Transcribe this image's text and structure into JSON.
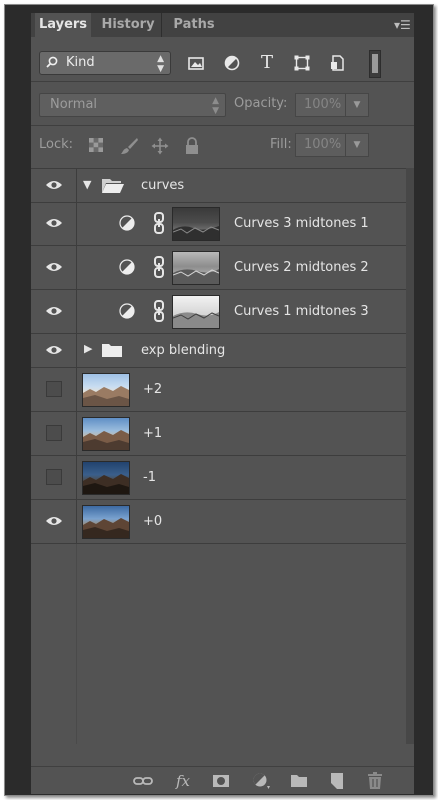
{
  "tabs": [
    {
      "label": "Layers",
      "active": true
    },
    {
      "label": "History",
      "active": false
    },
    {
      "label": "Paths",
      "active": false
    }
  ],
  "panel_menu_icon": "panel-menu-icon",
  "filter": {
    "kind_label": "Kind",
    "icons": [
      "image-filter-icon",
      "adjustment-filter-icon",
      "type-filter-icon",
      "shape-filter-icon",
      "smart-object-filter-icon"
    ],
    "type_glyph": "T"
  },
  "blend": {
    "mode": "Normal",
    "opacity_label": "Opacity:",
    "opacity_value": "100%"
  },
  "lock": {
    "label": "Lock:",
    "fill_label": "Fill:",
    "fill_value": "100%",
    "icons": [
      "lock-transparent-icon",
      "lock-image-icon",
      "lock-position-icon",
      "lock-all-icon"
    ]
  },
  "layers": [
    {
      "name": "curves",
      "kind": "group",
      "expanded": true,
      "visible": true,
      "indent": 0
    },
    {
      "name": "Curves 3 midtones 1",
      "kind": "adjustment",
      "visible": true,
      "indent": 1
    },
    {
      "name": "Curves 2 midtones 2",
      "kind": "adjustment",
      "visible": true,
      "indent": 1
    },
    {
      "name": "Curves 1 midtones 3",
      "kind": "adjustment",
      "visible": true,
      "indent": 1
    },
    {
      "name": "exp blending",
      "kind": "group",
      "expanded": false,
      "visible": true,
      "indent": 0
    },
    {
      "name": "+2",
      "kind": "image",
      "visible": false,
      "indent": 0
    },
    {
      "name": "+1",
      "kind": "image",
      "visible": false,
      "indent": 0
    },
    {
      "name": "-1",
      "kind": "image",
      "visible": false,
      "indent": 0
    },
    {
      "name": "+0",
      "kind": "image",
      "visible": true,
      "indent": 0
    }
  ],
  "bottom_icons": [
    "link-layers-icon",
    "fx-icon",
    "add-mask-icon",
    "new-adjustment-icon",
    "new-group-icon",
    "new-layer-icon",
    "delete-layer-icon"
  ],
  "bottom_fx_text": "fx",
  "colors": {
    "panel": "#535353",
    "tab_bar": "#424242",
    "text": "#e5e5e5",
    "disabled_text": "#9c9c9c"
  }
}
